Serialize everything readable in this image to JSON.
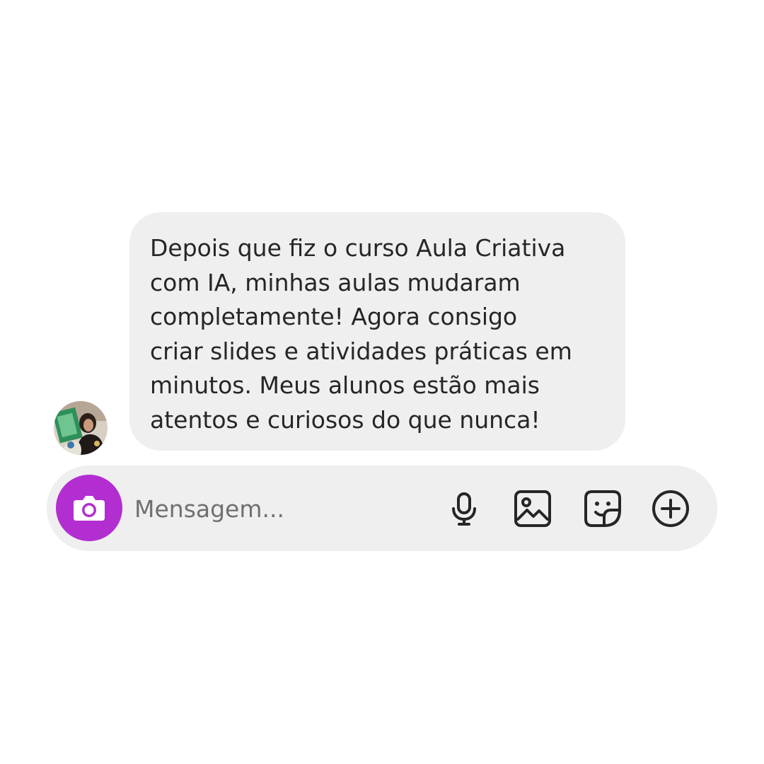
{
  "colors": {
    "background": "#ffffff",
    "bubble_background": "#efefef",
    "composer_background": "#efefef",
    "message_text": "#262626",
    "placeholder_text": "#707070",
    "camera_button": "#b32ed1",
    "icon_stroke": "#262626"
  },
  "conversation": {
    "received_message": {
      "avatar": "user-avatar-photo",
      "lines": [
        "Depois que fiz o curso Aula Criativa",
        "com IA, minhas aulas mudaram",
        "completamente! Agora consigo",
        "criar slides e atividades práticas em",
        "minutos. Meus alunos estão mais",
        "atentos e curiosos do que nunca!"
      ]
    }
  },
  "composer": {
    "placeholder": "Mensagem...",
    "icons": {
      "camera": "camera-icon",
      "microphone": "microphone-icon",
      "gallery": "gallery-icon",
      "sticker": "sticker-icon",
      "more": "plus-circle-icon"
    }
  }
}
